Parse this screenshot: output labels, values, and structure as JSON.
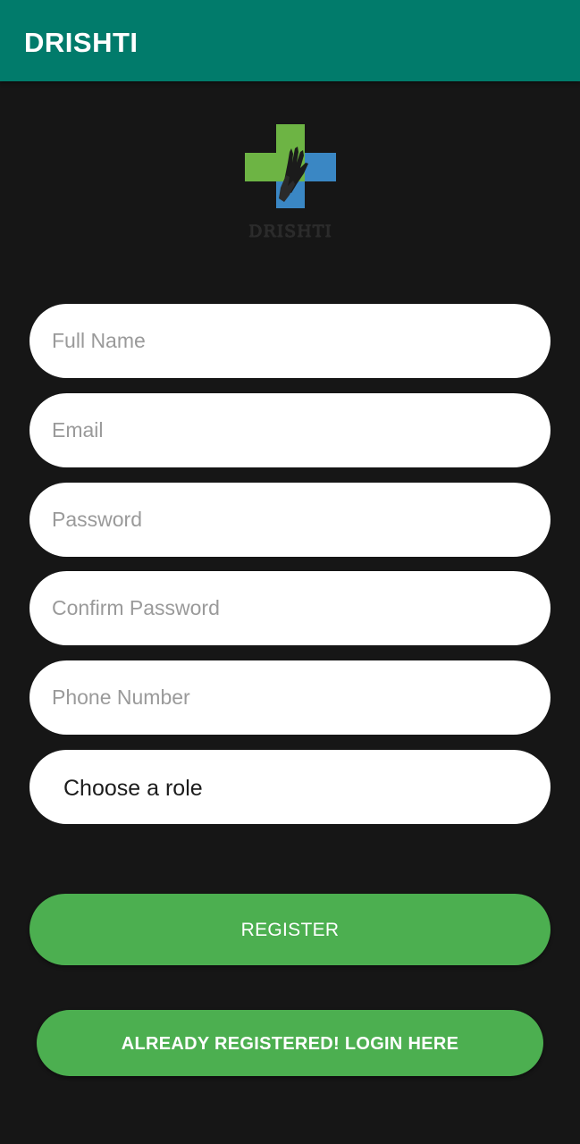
{
  "app_bar": {
    "title": "DRISHTI",
    "color": "#017B6B"
  },
  "logo": {
    "text": "DRISHTI",
    "icon": "medical-cross-hand-icon",
    "colors": {
      "green": "#6DB444",
      "blue": "#3A87C4"
    }
  },
  "form": {
    "full_name_placeholder": "Full Name",
    "email_placeholder": "Email",
    "password_placeholder": "Password",
    "confirm_password_placeholder": "Confirm Password",
    "phone_placeholder": "Phone Number",
    "role_selected": "Choose a role"
  },
  "buttons": {
    "register_label": "REGISTER",
    "login_label": "ALREADY REGISTERED! LOGIN HERE",
    "color": "#4CAF50"
  }
}
